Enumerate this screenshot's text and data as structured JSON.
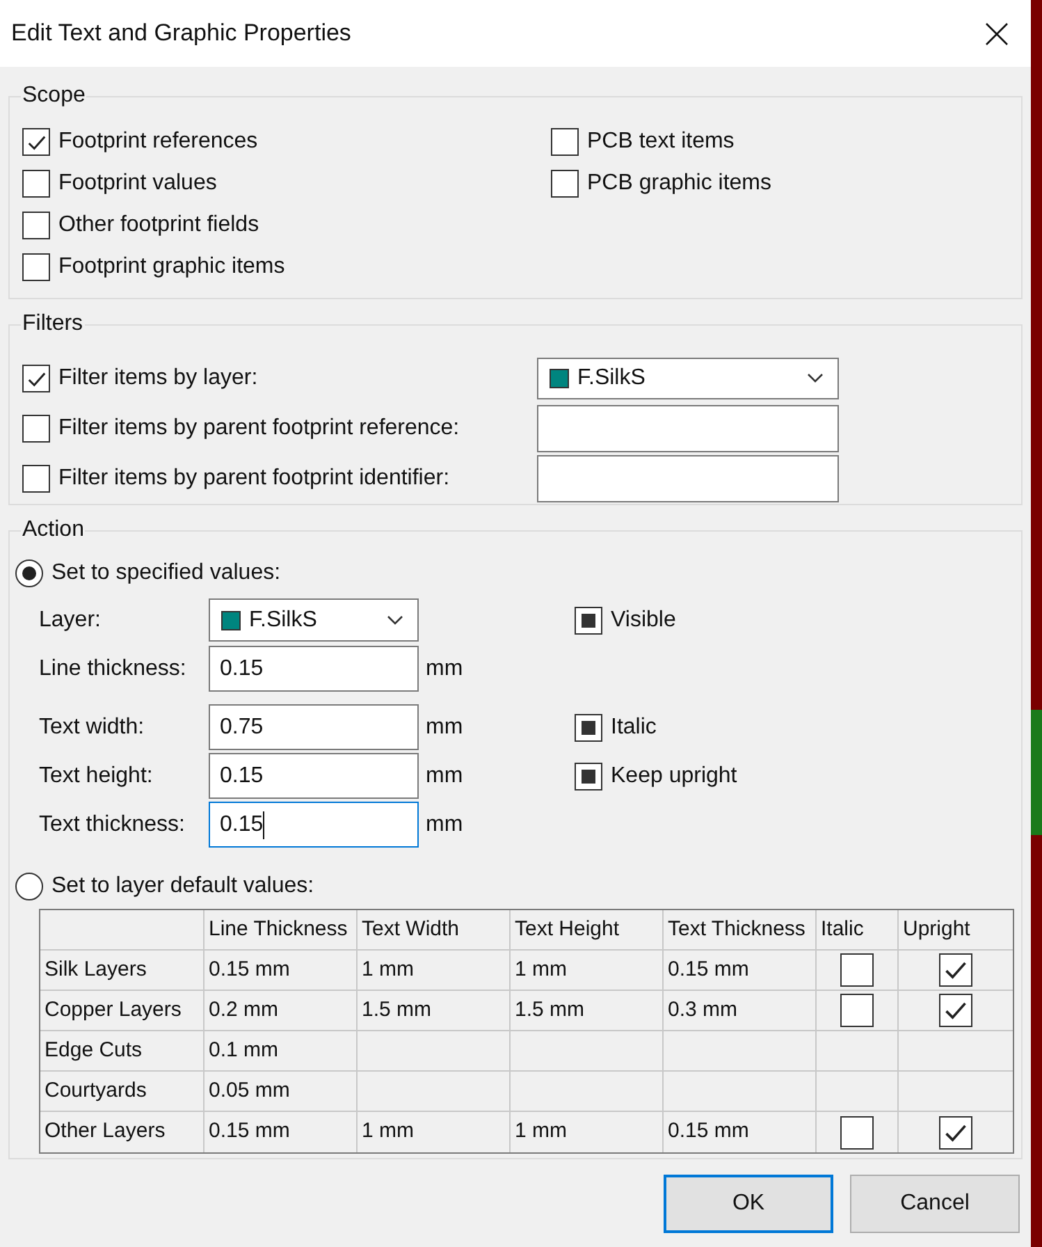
{
  "window": {
    "title": "Edit Text and Graphic Properties"
  },
  "scope": {
    "title": "Scope",
    "left": [
      {
        "label": "Footprint references",
        "checked": true
      },
      {
        "label": "Footprint values",
        "checked": false
      },
      {
        "label": "Other footprint fields",
        "checked": false
      },
      {
        "label": "Footprint graphic items",
        "checked": false
      }
    ],
    "right": [
      {
        "label": "PCB text items",
        "checked": false
      },
      {
        "label": "PCB graphic items",
        "checked": false
      }
    ]
  },
  "filters": {
    "title": "Filters",
    "rows": [
      {
        "kind": "dropdown",
        "label": "Filter items by layer:",
        "checked": true,
        "value": "F.SilkS"
      },
      {
        "kind": "text",
        "label": "Filter items by parent footprint reference:",
        "checked": false
      },
      {
        "kind": "text",
        "label": "Filter items by parent footprint identifier:",
        "checked": false
      }
    ]
  },
  "action": {
    "title": "Action",
    "specified": {
      "label": "Set to specified values:",
      "selected": true
    },
    "fields": [
      {
        "kind": "dropdown",
        "label": "Layer:",
        "value": "F.SilkS",
        "option": {
          "label": "Visible",
          "indeterminate": true
        }
      },
      {
        "kind": "text",
        "label": "Line thickness:",
        "value": "0.15",
        "unit": "mm",
        "focused": false
      },
      {
        "kind": "text",
        "label": "Text width:",
        "value": "0.75",
        "unit": "mm",
        "focused": false,
        "option": {
          "label": "Italic",
          "indeterminate": true
        }
      },
      {
        "kind": "text",
        "label": "Text height:",
        "value": "0.15",
        "unit": "mm",
        "focused": false,
        "option": {
          "label": "Keep upright",
          "indeterminate": true
        }
      },
      {
        "kind": "text",
        "label": "Text thickness:",
        "value": "0.15",
        "unit": "mm",
        "focused": true
      }
    ],
    "defaults": {
      "label": "Set to layer default values:",
      "selected": false
    },
    "table": {
      "columns": [
        "Line Thickness",
        "Text Width",
        "Text Height",
        "Text Thickness",
        "Italic",
        "Upright"
      ],
      "rows": [
        {
          "layer": "Silk Layers",
          "cells": [
            "0.15 mm",
            "1 mm",
            "1 mm",
            "0.15 mm"
          ],
          "italic": {
            "checked": false
          },
          "upright": {
            "checked": true
          }
        },
        {
          "layer": "Copper Layers",
          "cells": [
            "0.2 mm",
            "1.5 mm",
            "1.5 mm",
            "0.3 mm"
          ],
          "italic": {
            "checked": false
          },
          "upright": {
            "checked": true
          }
        },
        {
          "layer": "Edge Cuts",
          "cells": [
            "0.1 mm"
          ]
        },
        {
          "layer": "Courtyards",
          "cells": [
            "0.05 mm"
          ]
        },
        {
          "layer": "Other Layers",
          "cells": [
            "0.15 mm",
            "1 mm",
            "1 mm",
            "0.15 mm"
          ],
          "italic": {
            "checked": false
          },
          "upright": {
            "checked": true
          }
        }
      ]
    }
  },
  "buttons": [
    {
      "label": "OK",
      "default": true
    },
    {
      "label": "Cancel",
      "default": false
    }
  ]
}
